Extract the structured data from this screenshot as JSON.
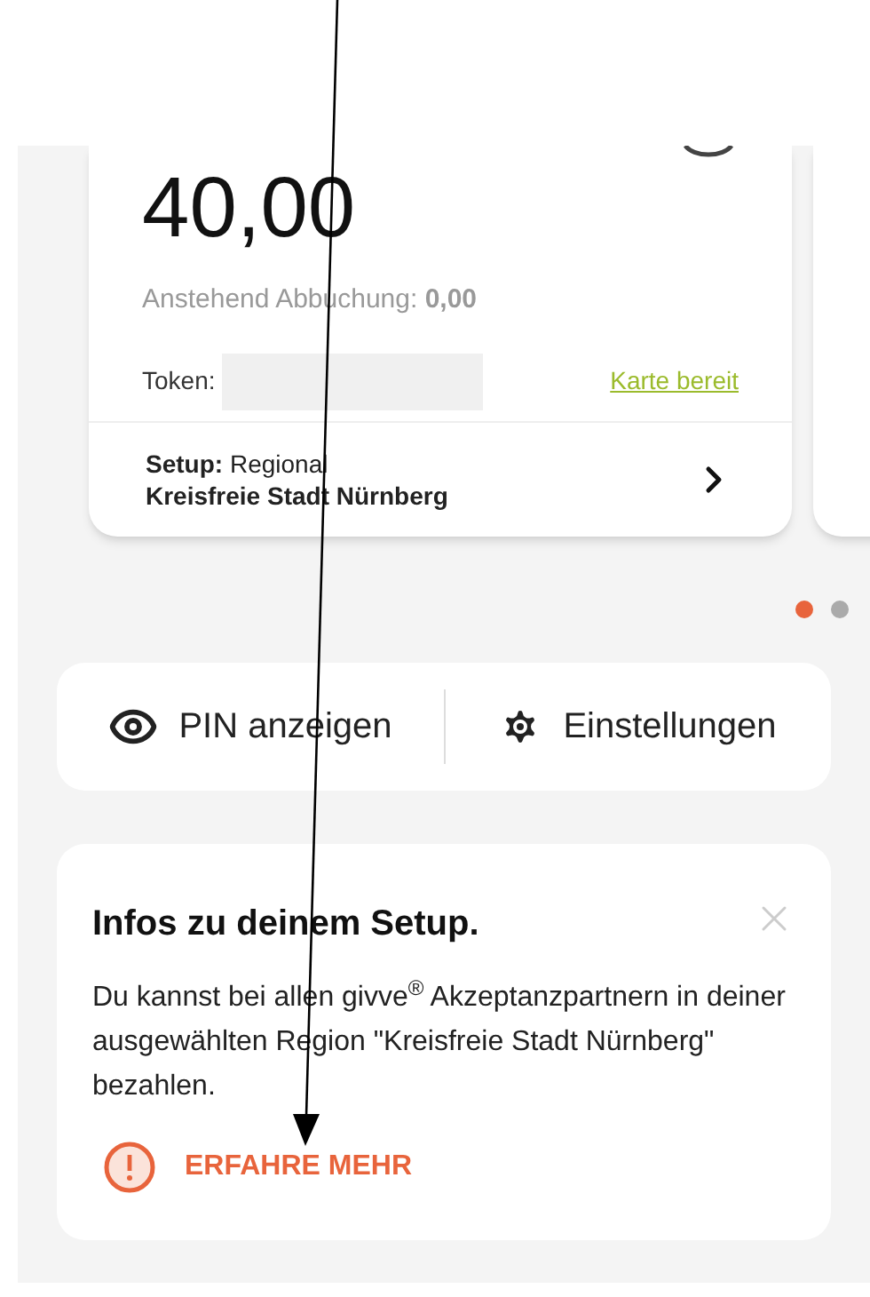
{
  "card": {
    "amount": "40,00",
    "pending": "Anstehend Abbuchung: **0,00**",
    "token_label": "Token:",
    "token_status": "Karte bereit",
    "setup": "**Setup:** Regional",
    "region": "Kreisfreie Stadt Nürnberg"
  },
  "pager": [
    {
      "selected": true
    },
    {
      "selected": false
    }
  ],
  "actions": [
    {
      "kind": "eye",
      "label": "PIN anzeigen"
    },
    {
      "kind": "gear",
      "label": "Einstellungen"
    }
  ],
  "info": {
    "title": "Infos zu deinem Setup.",
    "body": "Du kannst bei allen givve$^{®}$ Akzeptanzpartnern in deiner ausgewählten Region \"Kreisfreie Stadt Nürnberg\" bezahlen.",
    "link": "ERFAHRE MEHR"
  }
}
